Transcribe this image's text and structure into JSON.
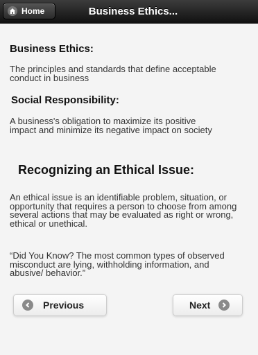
{
  "header": {
    "home_label": "Home",
    "title": "Business Ethics..."
  },
  "sections": {
    "business_ethics": {
      "heading": "Business Ethics:",
      "text": "The principles and standards that define acceptable conduct in business"
    },
    "social_responsibility": {
      "heading": "Social Responsibility:",
      "text": "A business's obligation to maximize its positive impact and minimize its negative impact on society"
    },
    "ethical_issue": {
      "heading": "Recognizing an Ethical Issue:",
      "text": "An ethical issue is an identifiable problem, situation, or opportunity that requires a person to choose from among several actions that may be evaluated as right or wrong, ethical or unethical.",
      "quote": "“Did You Know? The most common types of observed misconduct are lying, withholding information, and abusive/ behavior.”"
    }
  },
  "nav": {
    "previous_label": "Previous",
    "next_label": "Next"
  },
  "icons": {
    "home": "home-icon",
    "previous": "arrow-left-icon",
    "next": "arrow-right-icon"
  }
}
